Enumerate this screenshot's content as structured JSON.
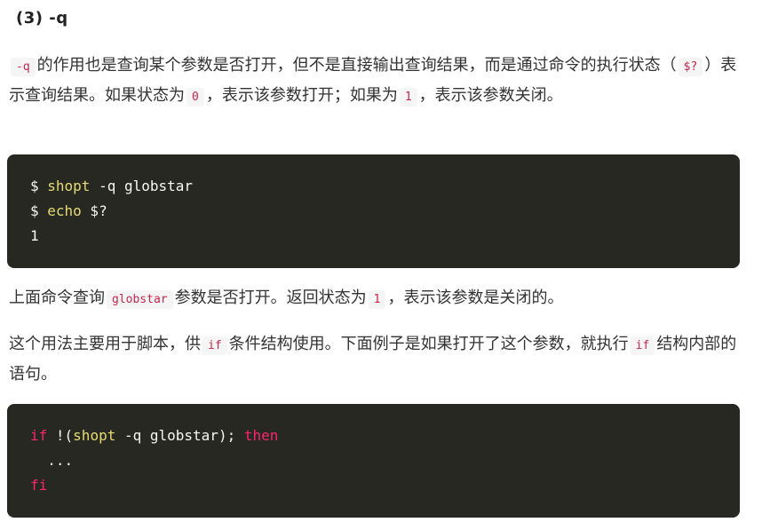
{
  "section_heading": "(3) -q",
  "para1": {
    "code1": "-q",
    "text1": "的作用也是查询某个参数是否打开，但不是直接输出查询结果，而是通过命令的执行状态（",
    "code2": "$?",
    "text2": "）表示查询结果。如果状态为",
    "code3": "0",
    "text3": "，表示该参数打开；如果为",
    "code4": "1",
    "text4": "，表示该参数关闭。"
  },
  "code_block1": {
    "line1": {
      "prompt": "$ ",
      "cmd": "shopt",
      "rest": " -q globstar"
    },
    "line2": {
      "prompt": "$ ",
      "cmd": "echo",
      "rest": " $?"
    },
    "line3": {
      "output": "1"
    }
  },
  "para2": {
    "text1": "上面命令查询",
    "code1": "globstar",
    "text2": "参数是否打开。返回状态为",
    "code2": "1",
    "text3": "，表示该参数是关闭的。"
  },
  "para3": {
    "text1": "这个用法主要用于脚本，供",
    "code1": "if",
    "text2": "条件结构使用。下面例子是如果打开了这个参数，就执行",
    "code2": "if",
    "text3": "结构内部的语句。"
  },
  "code_block2": {
    "line1": {
      "kw1": "if",
      "txt1": " !(",
      "fn": "shopt",
      "txt2": " -q globstar); ",
      "kw2": "then"
    },
    "line2": {
      "txt": "  ..."
    },
    "line3": {
      "kw": "fi"
    }
  }
}
